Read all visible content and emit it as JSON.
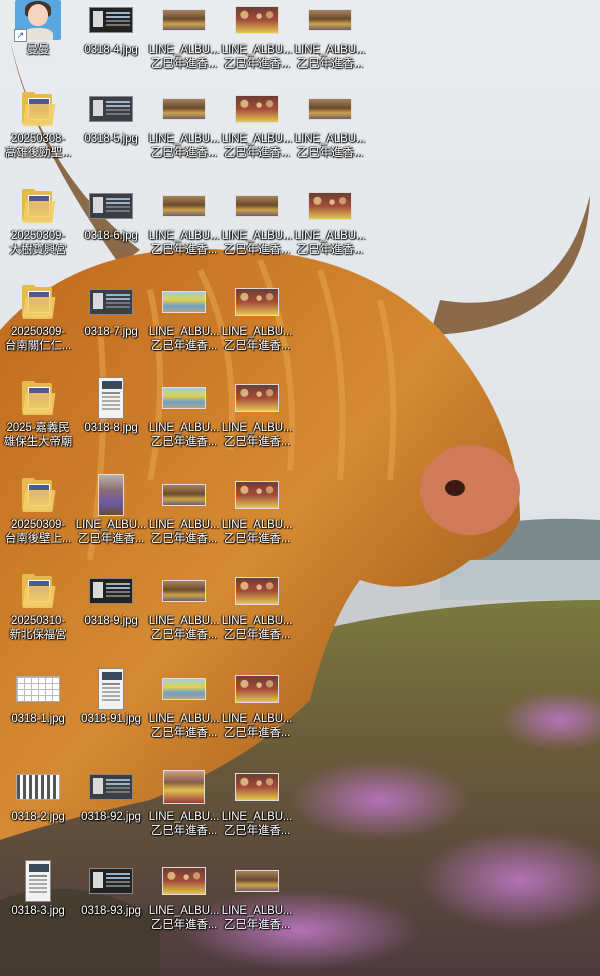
{
  "desktop": {
    "icons": [
      {
        "label": "曼曼",
        "type": "shortcut-avatar",
        "col": 0,
        "row": 0
      },
      {
        "label": "0318-4.jpg",
        "type": "shot-dark",
        "col": 1,
        "row": 0
      },
      {
        "label": "LINE_ALBU...\n乙巳年進香...",
        "type": "photo",
        "col": 2,
        "row": 0
      },
      {
        "label": "LINE_ALBU...\n乙巳年進香...",
        "type": "crowd",
        "col": 3,
        "row": 0
      },
      {
        "label": "LINE_ALBU...\n乙巳年進香...",
        "type": "photo",
        "col": 4,
        "row": 0
      },
      {
        "label": "20250308-\n高雄後勁聖...",
        "type": "folder",
        "col": 0,
        "row": 1
      },
      {
        "label": "0318-5.jpg",
        "type": "shot",
        "col": 1,
        "row": 1
      },
      {
        "label": "LINE_ALBU...\n乙巳年進香...",
        "type": "photo",
        "col": 2,
        "row": 1
      },
      {
        "label": "LINE_ALBU...\n乙巳年進香...",
        "type": "crowd",
        "col": 3,
        "row": 1
      },
      {
        "label": "LINE_ALBU...\n乙巳年進香...",
        "type": "photo",
        "col": 4,
        "row": 1
      },
      {
        "label": "20250309-\n大樹寶興宮",
        "type": "folder",
        "col": 0,
        "row": 2
      },
      {
        "label": "0318-6.jpg",
        "type": "shot",
        "col": 1,
        "row": 2
      },
      {
        "label": "LINE_ALBU...\n乙巳年進香...",
        "type": "photo",
        "col": 2,
        "row": 2
      },
      {
        "label": "LINE_ALBU...\n乙巳年進香...",
        "type": "photo",
        "col": 3,
        "row": 2
      },
      {
        "label": "LINE_ALBU...\n乙巳年進香...",
        "type": "crowd",
        "col": 4,
        "row": 2
      },
      {
        "label": "20250309-\n台南關仁仁...",
        "type": "folder",
        "col": 0,
        "row": 3
      },
      {
        "label": "0318-7.jpg",
        "type": "shot",
        "col": 1,
        "row": 3
      },
      {
        "label": "LINE_ALBU...\n乙巳年進香...",
        "type": "bright",
        "col": 2,
        "row": 3
      },
      {
        "label": "LINE_ALBU...\n乙巳年進香...",
        "type": "crowd",
        "col": 3,
        "row": 3
      },
      {
        "label": "2025-嘉義民\n雄保生大帝廟",
        "type": "folder",
        "col": 0,
        "row": 4
      },
      {
        "label": "0318-8.jpg",
        "type": "shot-tall",
        "col": 1,
        "row": 4
      },
      {
        "label": "LINE_ALBU...\n乙巳年進香...",
        "type": "bright",
        "col": 2,
        "row": 4
      },
      {
        "label": "LINE_ALBU...\n乙巳年進香...",
        "type": "crowd",
        "col": 3,
        "row": 4
      },
      {
        "label": "20250309-\n台南後壁上...",
        "type": "folder",
        "col": 0,
        "row": 5
      },
      {
        "label": "LINE_ALBU...\n乙巳年進香...",
        "type": "portrait",
        "col": 1,
        "row": 5
      },
      {
        "label": "LINE_ALBU...\n乙巳年進香...",
        "type": "photo",
        "col": 2,
        "row": 5
      },
      {
        "label": "LINE_ALBU...\n乙巳年進香...",
        "type": "crowd",
        "col": 3,
        "row": 5
      },
      {
        "label": "20250310-\n新北保福宮",
        "type": "folder",
        "col": 0,
        "row": 6
      },
      {
        "label": "0318-9.jpg",
        "type": "shot-dark",
        "col": 1,
        "row": 6
      },
      {
        "label": "LINE_ALBU...\n乙巳年進香...",
        "type": "photo",
        "col": 2,
        "row": 6
      },
      {
        "label": "LINE_ALBU...\n乙巳年進香...",
        "type": "crowd",
        "col": 3,
        "row": 6
      },
      {
        "label": "0318-1.jpg",
        "type": "grid-sheet",
        "col": 0,
        "row": 7
      },
      {
        "label": "0318-91.jpg",
        "type": "shot-tall",
        "col": 1,
        "row": 7
      },
      {
        "label": "LINE_ALBU...\n乙巳年進香...",
        "type": "bright",
        "col": 2,
        "row": 7
      },
      {
        "label": "LINE_ALBU...\n乙巳年進香...",
        "type": "crowd",
        "col": 3,
        "row": 7
      },
      {
        "label": "0318-2.jpg",
        "type": "doc-sheet",
        "col": 0,
        "row": 8
      },
      {
        "label": "0318-92.jpg",
        "type": "shot",
        "col": 1,
        "row": 8
      },
      {
        "label": "LINE_ALBU...\n乙巳年進香...",
        "type": "tall",
        "col": 2,
        "row": 8
      },
      {
        "label": "LINE_ALBU...\n乙巳年進香...",
        "type": "crowd",
        "col": 3,
        "row": 8
      },
      {
        "label": "0318-3.jpg",
        "type": "shot-tall",
        "col": 0,
        "row": 9
      },
      {
        "label": "0318-93.jpg",
        "type": "shot-dark",
        "col": 1,
        "row": 9
      },
      {
        "label": "LINE_ALBU...\n乙巳年進香...",
        "type": "crowd",
        "col": 2,
        "row": 9
      },
      {
        "label": "LINE_ALBU...\n乙巳年進香...",
        "type": "photo",
        "col": 3,
        "row": 9
      }
    ]
  }
}
